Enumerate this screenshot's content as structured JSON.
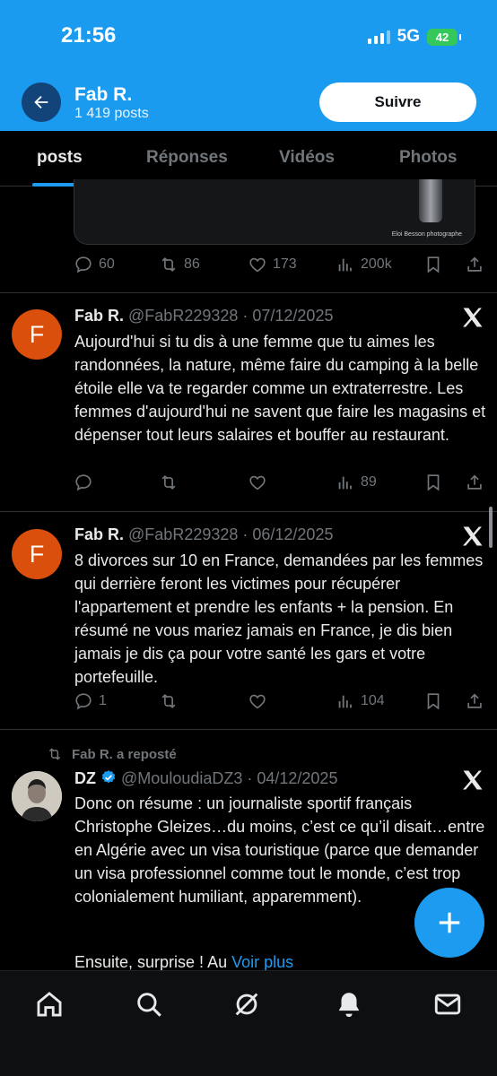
{
  "status_bar": {
    "time": "21:56",
    "network": "5G",
    "battery": "42"
  },
  "header": {
    "name": "Fab R.",
    "posts_count": "1 419 posts",
    "follow_label": "Suivre"
  },
  "tabs": [
    {
      "label": "posts",
      "active": true
    },
    {
      "label": "Réponses",
      "active": false
    },
    {
      "label": "Vidéos",
      "active": false
    },
    {
      "label": "Photos",
      "active": false
    }
  ],
  "previous_post": {
    "photo_credit": "Eloi Besson photographe",
    "replies": "60",
    "reposts": "86",
    "likes": "173",
    "views": "200k"
  },
  "posts": [
    {
      "avatar_letter": "F",
      "name": "Fab R.",
      "handle_date": "@FabR229328 · 07/12/2025",
      "text": "Aujourd'hui si tu dis à une femme que tu aimes les randonnées, la nature, même faire du camping à la belle étoile elle va te regarder comme un extraterrestre. Les femmes d'aujourd'hui ne savent que faire les magasins et dépenser tout leurs salaires et bouffer au restaurant.",
      "replies": "",
      "reposts": "",
      "likes": "",
      "views": "89"
    },
    {
      "avatar_letter": "F",
      "name": "Fab R.",
      "handle_date": "@FabR229328 · 06/12/2025",
      "text": "8 divorces sur 10 en France, demandées par les femmes qui derrière feront les victimes pour récupérer l'appartement et prendre les enfants + la pension. En résumé ne vous mariez jamais en France, je dis bien jamais je dis ça pour votre santé les gars et votre portefeuille.",
      "replies": "1",
      "reposts": "",
      "likes": "",
      "views": "104"
    }
  ],
  "repost": {
    "label": "Fab R. a reposté",
    "name": "DZ",
    "handle_date": "@MouloudiaDZ3 · 04/12/2025",
    "text": "Donc on résume : un journaliste sportif français Christophe Gleizes…du moins, c’est ce qu’il disait…entre en Algérie avec un visa touristique (parce que demander un visa professionnel comme tout le monde, c’est trop colonialement humiliant, apparemment).",
    "text_end": "Ensuite, surprise ! Au",
    "see_more": "Voir plus"
  },
  "colors": {
    "accent": "#1d9bf0",
    "header_bg": "#1b9bf0",
    "muted": "#71767b",
    "avatar_orange": "#d94f0b"
  },
  "icons": {
    "back": "arrow-left-icon",
    "x": "x-logo-icon",
    "reply": "reply-icon",
    "repost": "repost-icon",
    "like": "heart-icon",
    "views": "views-icon",
    "bookmark": "bookmark-icon",
    "share": "share-icon",
    "compose": "plus-icon",
    "home": "home-icon",
    "search": "search-icon",
    "grok": "grok-icon",
    "notifications": "bell-icon",
    "messages": "mail-icon"
  }
}
